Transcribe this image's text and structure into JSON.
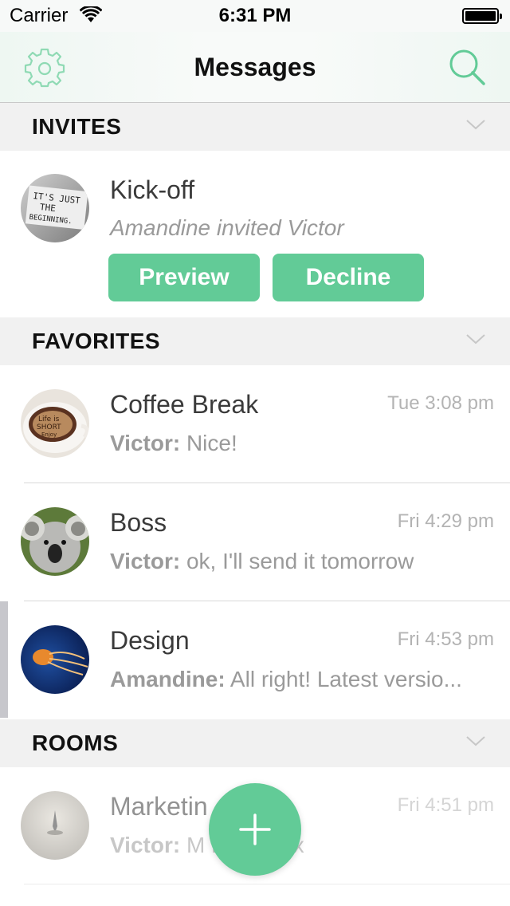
{
  "status_bar": {
    "carrier": "Carrier",
    "time": "6:31 PM"
  },
  "nav": {
    "title": "Messages",
    "left_icon": "gear-icon",
    "right_icon": "search-icon"
  },
  "colors": {
    "accent": "#62cb97",
    "header_bg": "#f1f1f1",
    "text": "#3a3a3a",
    "muted": "#9a9a9a"
  },
  "sections": {
    "invites": {
      "title": "INVITES",
      "items": [
        {
          "name": "Kick-off",
          "subtitle": "Amandine invited Victor",
          "preview_label": "Preview",
          "decline_label": "Decline"
        }
      ]
    },
    "favorites": {
      "title": "FAVORITES",
      "items": [
        {
          "name": "Coffee Break",
          "time": "Tue 3:08 pm",
          "sender": "Victor:",
          "message": "Nice!"
        },
        {
          "name": "Boss",
          "time": "Fri 4:29 pm",
          "sender": "Victor:",
          "message": "ok, I'll send it tomorrow"
        },
        {
          "name": "Design",
          "time": "Fri 4:53 pm",
          "sender": "Amandine:",
          "message": "All right! Latest versio..."
        }
      ]
    },
    "rooms": {
      "title": "ROOMS",
      "items": [
        {
          "name": "Marketin",
          "time": "Fri 4:51 pm",
          "sender": "Victor:",
          "message": "M Plan.pptx"
        }
      ]
    }
  },
  "fab": {
    "icon": "plus-icon"
  }
}
